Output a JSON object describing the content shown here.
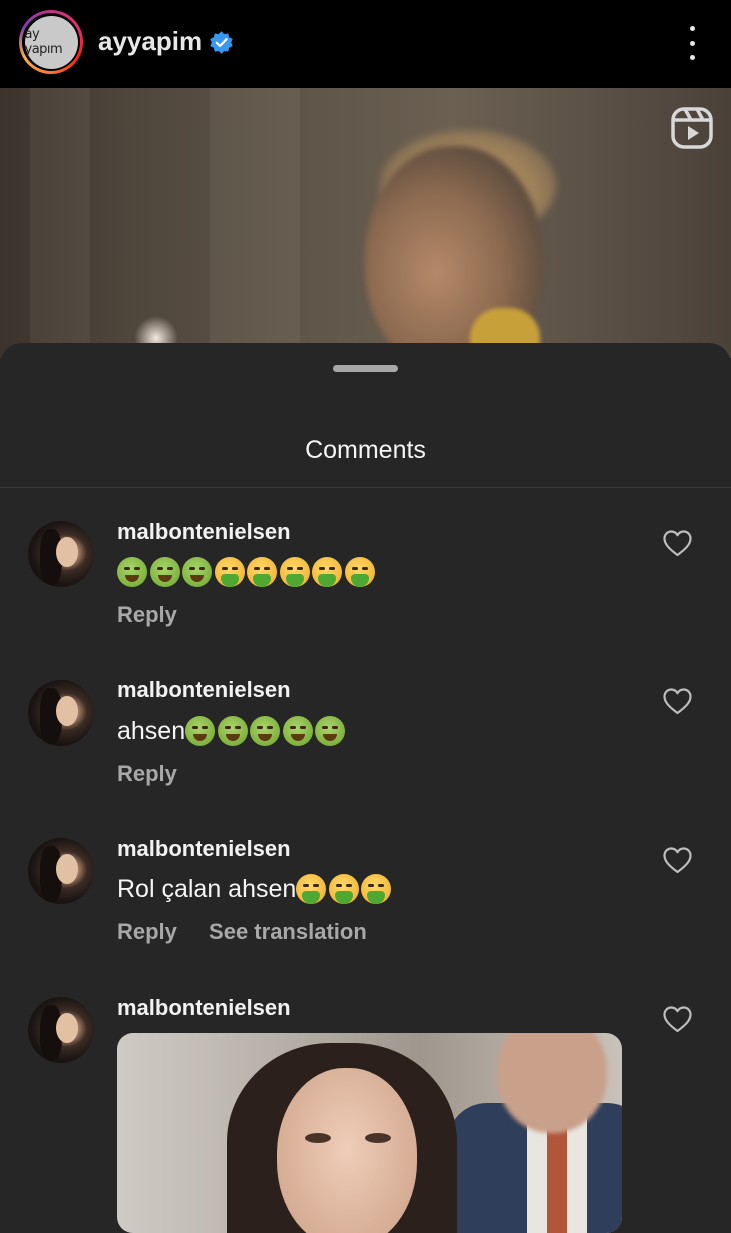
{
  "header": {
    "avatar_text": "ay yapım",
    "username": "ayyapim",
    "verified_icon": "verified-badge-icon",
    "menu_icon": "more-vertical-icon"
  },
  "video": {
    "reels_icon": "reels-icon"
  },
  "sheet": {
    "title": "Comments"
  },
  "comments": [
    {
      "username": "malbontenielsen",
      "text": "",
      "emojis": [
        "nauseated",
        "nauseated",
        "nauseated",
        "vomit",
        "vomit",
        "vomit",
        "vomit",
        "vomit"
      ],
      "reply_label": "Reply",
      "translate_label": ""
    },
    {
      "username": "malbontenielsen",
      "text": "ahsen",
      "emojis": [
        "nauseated",
        "nauseated",
        "nauseated",
        "nauseated",
        "nauseated"
      ],
      "reply_label": "Reply",
      "translate_label": ""
    },
    {
      "username": "malbontenielsen",
      "text": "Rol çalan ahsen",
      "emojis": [
        "vomit",
        "vomit",
        "vomit"
      ],
      "reply_label": "Reply",
      "translate_label": "See translation"
    },
    {
      "username": "malbontenielsen",
      "text": "",
      "emojis": [],
      "reply_label": "",
      "translate_label": ""
    }
  ],
  "colors": {
    "background": "#262626",
    "header": "#000000",
    "verified": "#3897f0",
    "secondary_text": "#a8a8a8"
  }
}
